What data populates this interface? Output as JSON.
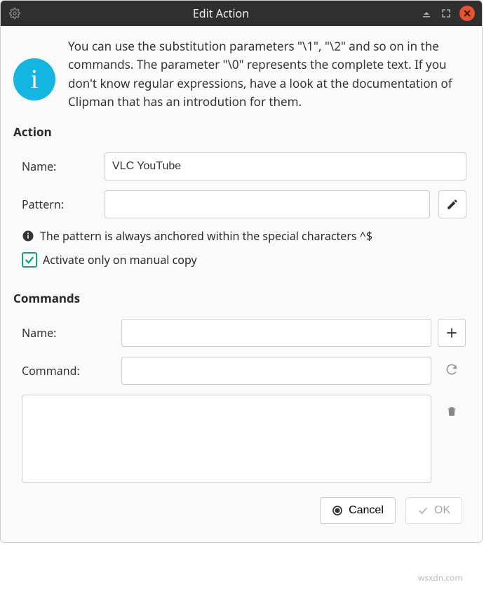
{
  "titlebar": {
    "title": "Edit Action"
  },
  "info": {
    "text": "You can use the substitution parameters \"\\1\", \"\\2\" and so on in the commands. The parameter \"\\0\" represents the complete text. If you don't know regular expressions, have a look at the documentation of Clipman that has an introdution for them."
  },
  "action": {
    "heading": "Action",
    "name_label": "Name:",
    "name_value": "VLC YouTube",
    "pattern_label": "Pattern:",
    "pattern_value": "",
    "hint": "The pattern is always anchored within the special characters ^$",
    "checkbox_label": "Activate only on manual copy",
    "checkbox_checked": true
  },
  "commands": {
    "heading": "Commands",
    "name_label": "Name:",
    "name_value": "",
    "command_label": "Command:",
    "command_value": ""
  },
  "footer": {
    "cancel": "Cancel",
    "ok": "OK"
  },
  "watermark": "wsxdn.com"
}
